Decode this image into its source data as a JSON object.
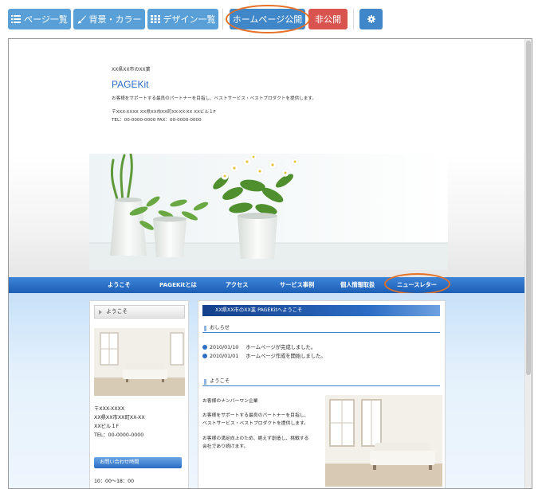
{
  "toolbar": {
    "page_list_label": "ページ一覧",
    "background_color_label": "背景・カラー",
    "design_list_label": "デザイン一覧",
    "publish_label": "ホームページ公開",
    "unpublish_label": "非公開",
    "settings_icon": "gear-icon",
    "colors": {
      "light_blue": "#5aa0d8",
      "blue": "#3f87c9",
      "red": "#d9534f",
      "highlight_ring": "#e57025"
    }
  },
  "site": {
    "company_small": "XX県XX市のXX業",
    "title": "PAGEKit",
    "description": "お客様をサポートする最良のパートナーを目指し、ベストサービス・ベストプロダクトを提供します。",
    "address_line": "〒XXX-XXXX  XX県XX市XX町XX-XX-XX  XXビル１F",
    "phone_line": "TEL：00-0000-0000  FAX：00-0000-0000"
  },
  "nav": {
    "items": [
      "ようこそ",
      "PAGEKitとは",
      "アクセス",
      "サービス事例",
      "個人情報取扱",
      "ニュースレター"
    ]
  },
  "sidebar": {
    "heading": "ようこそ",
    "address": [
      "〒XXX-XXXX",
      "XX県XX市XX町XX-XX",
      "XXビル１F",
      "TEL：00-0000-0000"
    ],
    "contact_heading": "お問い合わせ時間",
    "hours": "10：00～18：00"
  },
  "main": {
    "title": "XX県XX市のXX業  PAGEKitへようこそ",
    "news_heading": "おしらせ",
    "news": [
      {
        "date": "2010/01/10",
        "text": "ホームページが完成しました。"
      },
      {
        "date": "2010/01/01",
        "text": "ホームページ作成を開始しました。"
      }
    ],
    "welcome_heading": "ようこそ",
    "lead": "お客様のナンバーワン企業",
    "para1": [
      "お客様をサポートする最良のパートナーを目指し、",
      "ベストサービス・ベストプロダクトを提供します。"
    ],
    "para2": [
      "お客様の満足向上のため、絶えず創造し、挑戦する",
      "会社であり続けます。"
    ]
  }
}
